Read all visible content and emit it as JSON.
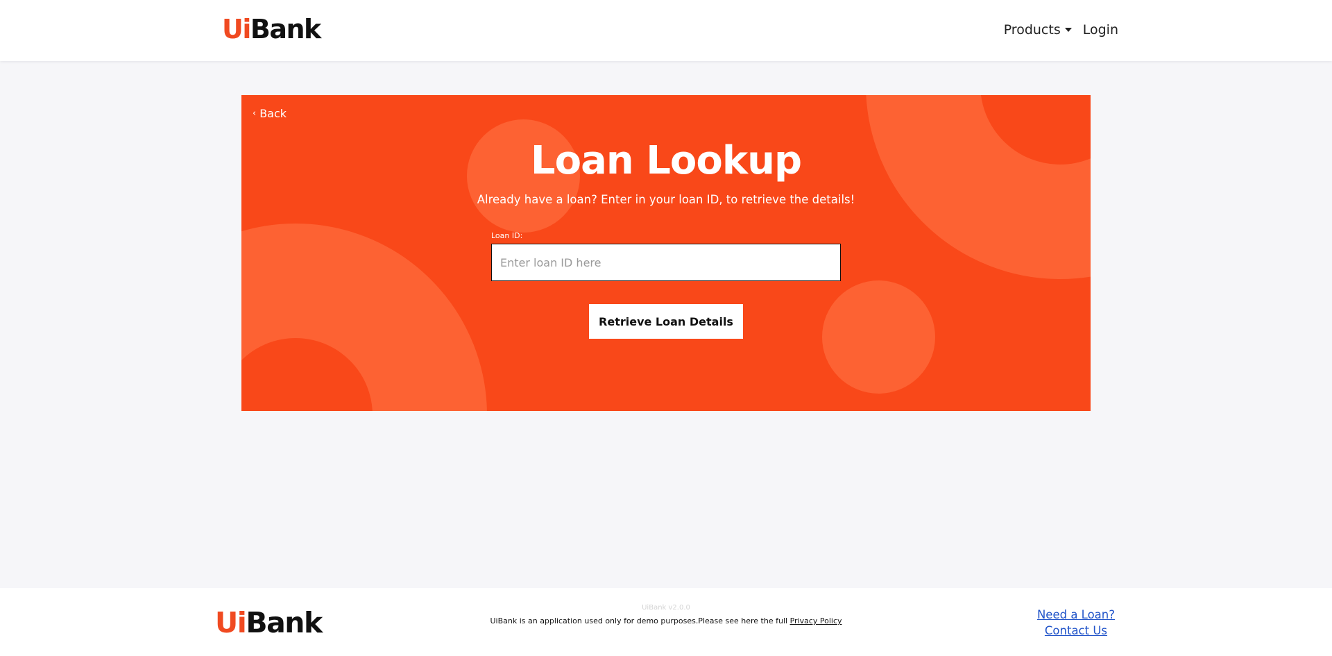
{
  "header": {
    "logo_ui": "Ui",
    "logo_bank": "Bank",
    "nav": {
      "products_label": "Products",
      "login_label": "Login"
    }
  },
  "hero": {
    "back_label": "Back",
    "title": "Loan Lookup",
    "subtitle": "Already have a loan? Enter in your loan ID, to retrieve the details!",
    "loan_id_label": "Loan ID:",
    "loan_id_placeholder": "Enter loan ID here",
    "loan_id_value": "",
    "retrieve_button_label": "Retrieve Loan Details"
  },
  "footer": {
    "logo_ui": "Ui",
    "logo_bank": "Bank",
    "version": "UiBank v2.0.0",
    "disclaimer_text": "UiBank is an application used only for demo purposes.Please see here the full ",
    "privacy_link_label": "Privacy Policy",
    "need_loan_label": "Need a Loan?",
    "contact_us_label": "Contact Us"
  },
  "colors": {
    "brand_orange": "#f94819",
    "logo_orange": "#f04a21",
    "deco_orange": "#fd6233",
    "link_blue": "#2154c9",
    "page_bg": "#f6f6f9"
  }
}
